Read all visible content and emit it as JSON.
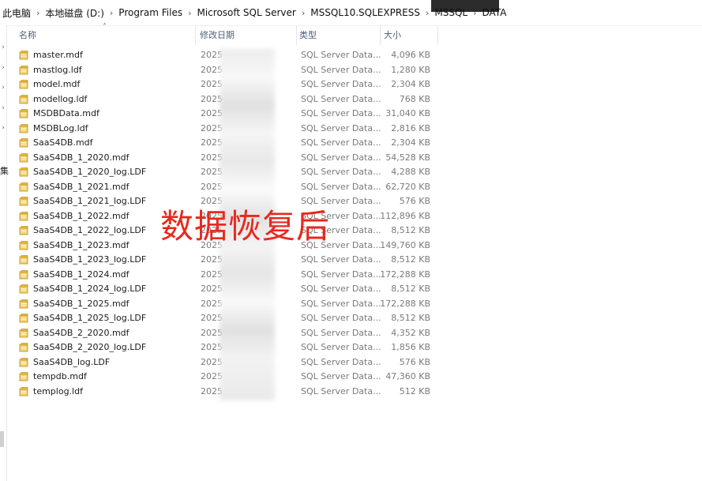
{
  "breadcrumb": [
    "此电脑",
    "本地磁盘 (D:)",
    "Program Files",
    "Microsoft SQL Server",
    "MSSQL10.SQLEXPRESS",
    "MSSQL",
    "DATA"
  ],
  "columns": {
    "name": "名称",
    "date": "修改日期",
    "type": "类型",
    "size": "大小"
  },
  "files": [
    {
      "name": "master.mdf",
      "date": "2025",
      "type": "SQL Server Data...",
      "size": "4,096 KB"
    },
    {
      "name": "mastlog.ldf",
      "date": "2025",
      "type": "SQL Server Data...",
      "size": "1,280 KB"
    },
    {
      "name": "model.mdf",
      "date": "2025",
      "type": "SQL Server Data...",
      "size": "2,304 KB"
    },
    {
      "name": "modellog.ldf",
      "date": "2025",
      "type": "SQL Server Data...",
      "size": "768 KB"
    },
    {
      "name": "MSDBData.mdf",
      "date": "2025",
      "type": "SQL Server Data...",
      "size": "31,040 KB"
    },
    {
      "name": "MSDBLog.ldf",
      "date": "2025",
      "type": "SQL Server Data...",
      "size": "2,816 KB"
    },
    {
      "name": "SaaS4DB.mdf",
      "date": "2025",
      "type": "SQL Server Data...",
      "size": "2,304 KB"
    },
    {
      "name": "SaaS4DB_1_2020.mdf",
      "date": "2025",
      "type": "SQL Server Data...",
      "size": "54,528 KB"
    },
    {
      "name": "SaaS4DB_1_2020_log.LDF",
      "date": "2025",
      "type": "SQL Server Data...",
      "size": "4,288 KB"
    },
    {
      "name": "SaaS4DB_1_2021.mdf",
      "date": "2025",
      "type": "SQL Server Data...",
      "size": "62,720 KB"
    },
    {
      "name": "SaaS4DB_1_2021_log.LDF",
      "date": "2025",
      "type": "SQL Server Data...",
      "size": "576 KB"
    },
    {
      "name": "SaaS4DB_1_2022.mdf",
      "date": "2025",
      "type": "SQL Server Data...",
      "size": "112,896 KB"
    },
    {
      "name": "SaaS4DB_1_2022_log.LDF",
      "date": "2025",
      "type": "SQL Server Data...",
      "size": "8,512 KB"
    },
    {
      "name": "SaaS4DB_1_2023.mdf",
      "date": "2025",
      "type": "SQL Server Data...",
      "size": "149,760 KB"
    },
    {
      "name": "SaaS4DB_1_2023_log.LDF",
      "date": "2025",
      "type": "SQL Server Data...",
      "size": "8,512 KB"
    },
    {
      "name": "SaaS4DB_1_2024.mdf",
      "date": "2025",
      "type": "SQL Server Data...",
      "size": "172,288 KB"
    },
    {
      "name": "SaaS4DB_1_2024_log.LDF",
      "date": "2025",
      "type": "SQL Server Data...",
      "size": "8,512 KB"
    },
    {
      "name": "SaaS4DB_1_2025.mdf",
      "date": "2025",
      "type": "SQL Server Data...",
      "size": "172,288 KB"
    },
    {
      "name": "SaaS4DB_1_2025_log.LDF",
      "date": "2025",
      "type": "SQL Server Data...",
      "size": "8,512 KB"
    },
    {
      "name": "SaaS4DB_2_2020.mdf",
      "date": "2025",
      "type": "SQL Server Data...",
      "size": "4,352 KB"
    },
    {
      "name": "SaaS4DB_2_2020_log.LDF",
      "date": "2025",
      "type": "SQL Server Data...",
      "size": "1,856 KB"
    },
    {
      "name": "SaaS4DB_log.LDF",
      "date": "2025",
      "type": "SQL Server Data...",
      "size": "576 KB"
    },
    {
      "name": "tempdb.mdf",
      "date": "2025",
      "type": "SQL Server Data...",
      "size": "47,360 KB"
    },
    {
      "name": "templog.ldf",
      "date": "2025",
      "type": "SQL Server Data...",
      "size": "512 KB"
    }
  ],
  "left_pane": {
    "glyph": "集"
  },
  "overlay": {
    "text": "数据恢复后",
    "color": "#e8281e"
  },
  "icons": {
    "file": "sql-data-file-icon",
    "separator": "chevron-right-icon",
    "sort": "sort-up-icon"
  }
}
